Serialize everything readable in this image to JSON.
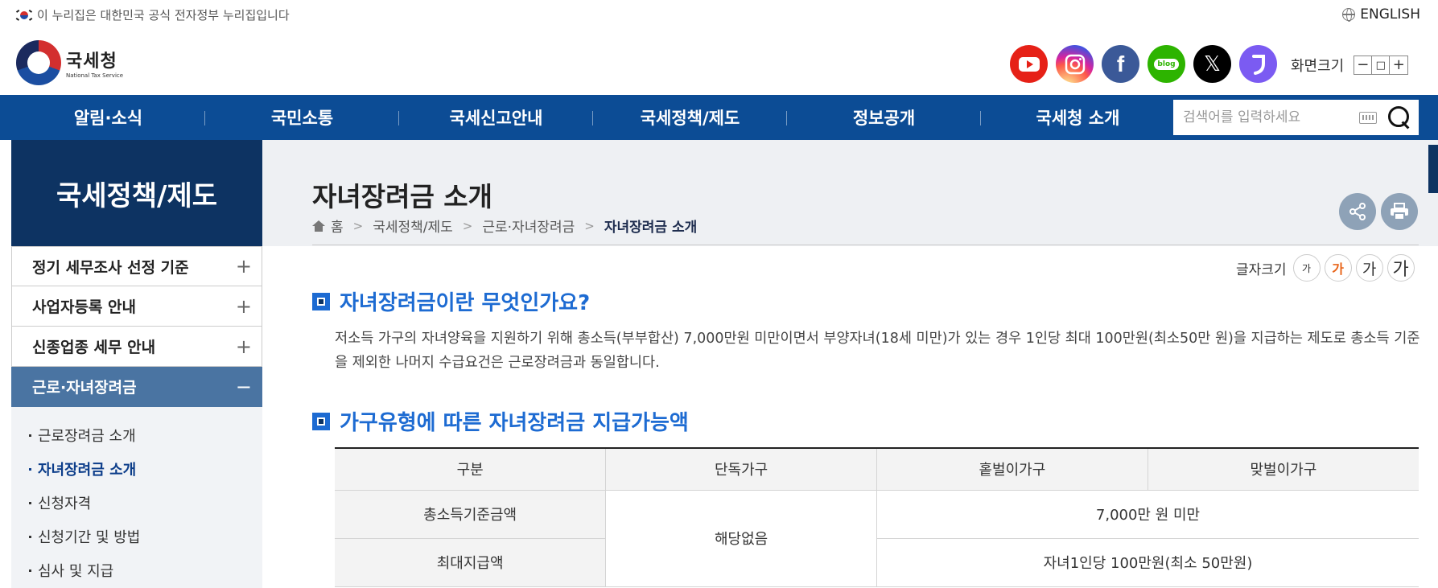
{
  "gov_notice": "이 누리집은 대한민국 공식 전자정부 누리집입니다",
  "language_link": "ENGLISH",
  "logo": {
    "ko": "국세청",
    "en": "National Tax Service"
  },
  "sns": [
    {
      "name": "youtube",
      "glyph": "▶"
    },
    {
      "name": "instagram",
      "glyph": "◎"
    },
    {
      "name": "facebook",
      "glyph": "f"
    },
    {
      "name": "blog",
      "glyph": "blog"
    },
    {
      "name": "x",
      "glyph": "𝕏"
    },
    {
      "name": "kakao",
      "glyph": "ꟼ"
    }
  ],
  "zoom": {
    "label": "화면크기",
    "minus": "−",
    "reset": "□",
    "plus": "+"
  },
  "nav": [
    "알림·소식",
    "국민소통",
    "국세신고안내",
    "국세정책/제도",
    "정보공개",
    "국세청 소개"
  ],
  "search": {
    "placeholder": "검색어를 입력하세요"
  },
  "sidebar": {
    "title": "국세정책/제도",
    "items": [
      {
        "label": "정기 세무조사 선정 기준",
        "sign": "+"
      },
      {
        "label": "사업자등록 안내",
        "sign": "+"
      },
      {
        "label": "신종업종 세무 안내",
        "sign": "+"
      },
      {
        "label": "근로·자녀장려금",
        "sign": "−"
      }
    ],
    "sub_items": [
      "근로장려금 소개",
      "자녀장려금 소개",
      "신청자격",
      "신청기간 및 방법",
      "심사 및 지급"
    ]
  },
  "page": {
    "title": "자녀장려금 소개",
    "breadcrumb": [
      "홈",
      "국세정책/제도",
      "근로·자녀장려금",
      "자녀장려금 소개"
    ]
  },
  "font_size": {
    "label": "글자크기",
    "buttons": [
      "가",
      "가",
      "가",
      "가"
    ]
  },
  "sections": [
    {
      "title": "자녀장려금이란 무엇인가요?",
      "body": "저소득 가구의 자녀양육을 지원하기 위해 총소득(부부합산) 7,000만원 미만이면서 부양자녀(18세 미만)가 있는 경우 1인당 최대 100만원(최소50만 원)을 지급하는 제도로 총소득 기준을 제외한 나머지 수급요건은 근로장려금과 동일합니다."
    },
    {
      "title": "가구유형에 따른 자녀장려금 지급가능액"
    }
  ],
  "table": {
    "headers": [
      "구분",
      "단독가구",
      "홑벌이가구",
      "맞벌이가구"
    ],
    "rows": [
      {
        "label": "총소득기준금액",
        "single": "해당없음",
        "couple": "7,000만 원 미만"
      },
      {
        "label": "최대지급액",
        "couple": "자녀1인당 100만원(최소 50만원)"
      }
    ]
  },
  "colors": {
    "nav": "#0c4c95",
    "sidebar_title": "#0d3362",
    "accent": "#1d6bd2",
    "sidebar_active": "#4a74a2"
  }
}
